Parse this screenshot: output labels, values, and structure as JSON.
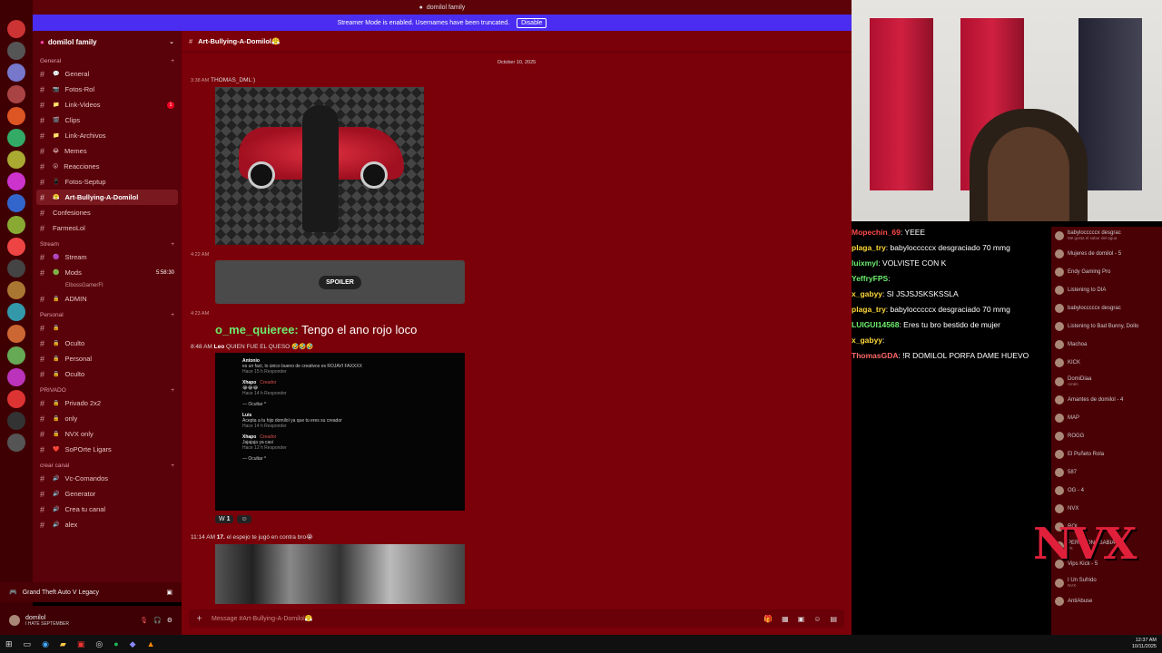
{
  "window": {
    "title": "domilol family"
  },
  "banner": {
    "text": "Streamer Mode is enabled. Usernames have been truncated.",
    "disable_label": "Disable"
  },
  "server": {
    "name": "domilol family"
  },
  "sidebar": {
    "categories": [
      {
        "label": "General",
        "channels": [
          {
            "label": "General",
            "emoji": "💬"
          },
          {
            "label": "Fotos-Rol",
            "emoji": "📷"
          },
          {
            "label": "Link-Videos",
            "emoji": "📁",
            "badge": "1"
          },
          {
            "label": "Clips",
            "emoji": "🎬"
          },
          {
            "label": "Link-Archivos",
            "emoji": "📁"
          },
          {
            "label": "Memes",
            "emoji": "😂"
          },
          {
            "label": "Reacciones",
            "emoji": "😮"
          },
          {
            "label": "Fotos-Septup",
            "emoji": "📱"
          },
          {
            "label": "Art-Bullying-A-Domilol",
            "emoji": "😤",
            "active": true
          },
          {
            "label": "Confesiones"
          },
          {
            "label": "FarmeoLol"
          }
        ]
      },
      {
        "label": "Stream",
        "channels": [
          {
            "label": "Stream",
            "emoji": "🟣"
          },
          {
            "label": "Mods",
            "emoji": "🟢",
            "time": "5:58:30"
          },
          {
            "label": "ElbossGamerFI",
            "sub": true
          },
          {
            "label": "ADMIN",
            "emoji": "🔒"
          }
        ]
      },
      {
        "label": "Personal",
        "channels": [
          {
            "label": "",
            "emoji": "🔒"
          },
          {
            "label": "Oculto",
            "emoji": "🔒"
          },
          {
            "label": "Personal",
            "emoji": "🔒"
          },
          {
            "label": "Oculto",
            "emoji": "🔒"
          }
        ]
      },
      {
        "label": "PRIVADO",
        "channels": [
          {
            "label": "Privado 2x2",
            "emoji": "🔒"
          },
          {
            "label": "only",
            "emoji": "🔒"
          },
          {
            "label": "NVX only",
            "emoji": "🔒"
          },
          {
            "label": "SoPOrte Ligars",
            "emoji": "❤️"
          }
        ]
      },
      {
        "label": "crear canal",
        "channels": [
          {
            "label": "Vc-Comandos",
            "emoji": "🔊"
          },
          {
            "label": "Generator",
            "emoji": "🔊"
          },
          {
            "label": "Crea tu canal",
            "emoji": "🔊"
          },
          {
            "label": "alex",
            "emoji": "🔊"
          }
        ]
      }
    ]
  },
  "game": {
    "label": "Grand Theft Auto V Legacy"
  },
  "user": {
    "name": "domilol",
    "status": "I HATE SEPTEMBER"
  },
  "chat": {
    "channel_name": "Art-Bullying-A-Domilol😤",
    "date_divider": "October 10, 2025",
    "msg1": {
      "time": "3:38 AM",
      "author": "THOMAS_DML:)"
    },
    "msg2": {
      "time": "4:22 AM",
      "spoiler_label": "SPOILER"
    },
    "msg3": {
      "time": "4:23 AM"
    },
    "overlay": {
      "name": "o_me_quieree:",
      "text": "Tengo el ano rojo loco"
    },
    "msg4": {
      "time": "8:48 AM",
      "author": "Leo",
      "text": "QUIEN FUE EL QUESO 🤣🤣🤣"
    },
    "shot": [
      {
        "name": "Antonio",
        "text": "es un fact, lo único bueno de creativos es ROJAVI FAXXXX",
        "meta": "Hace 15 h   Responder"
      },
      {
        "name": "Xhapo",
        "creator": "Creador",
        "text": "😂😂😂",
        "meta": "Hace 14 h   Responder"
      },
      {
        "name": "",
        "text": "— Ocultar ^",
        "meta": ""
      },
      {
        "name": "Luis",
        "text": "Acepta a tu hijo domilol ya que tu eres su creador",
        "meta": "Hace 14 h   Responder"
      },
      {
        "name": "Xhapo",
        "creator": "Creador",
        "text": "Jajajaja ya casi",
        "meta": "Hace 12 h   Responder"
      },
      {
        "name": "",
        "text": "— Ocultar ^",
        "meta": ""
      }
    ],
    "reactions": {
      "count": "1"
    },
    "msg5": {
      "time": "11:14 AM",
      "author": "17.",
      "text": "el espejo te jugó en contra bro😭"
    },
    "composer_placeholder": "Message #Art-Bullying-A-Domilol😤"
  },
  "twitch_chat": [
    {
      "user": "Mopechin_69",
      "color": "#ff4a4a",
      "text": ": YEEE"
    },
    {
      "user": "plaga_try",
      "color": "#ffd83a",
      "text": ": babylocccccx desgraciado 70 mmg"
    },
    {
      "user": "luixmyl",
      "color": "#6ef06e",
      "text": ": VOLVISTE CON K"
    },
    {
      "user": "YeffryFPS",
      "color": "#6ef06e",
      "text": ":"
    },
    {
      "user": "x_gabyy",
      "color": "#ffd83a",
      "text": ": SI JSJSJSKSKSSLA"
    },
    {
      "user": "plaga_try",
      "color": "#ffd83a",
      "text": ": babylocccccx desgraciado 70 mmg"
    },
    {
      "user": "LUIGUI14568",
      "color": "#6ef06e",
      "text": ": Eres tu bro bestido de mujer"
    },
    {
      "user": "x_gabyy",
      "color": "#ffd83a",
      "text": ":"
    },
    {
      "user": "ThomasGDA",
      "color": "#ff6a6a",
      "text": ": !R DOMILOL PORFA DAME HUEVO"
    }
  ],
  "members": {
    "rows": [
      {
        "name": "babylocccccx desgrac",
        "sub": "Me gusta el sabor del agua"
      },
      {
        "name": "Mujeres de domilol - 5"
      },
      {
        "name": "Endy Gaming Pro"
      },
      {
        "name": "Listening to DIA"
      },
      {
        "name": "babylocccccx desgrac"
      },
      {
        "name": "Listening to Bad Bunny, Dollo"
      },
      {
        "name": "Machoa"
      },
      {
        "name": "KICK"
      },
      {
        "name": "DomiDiaa",
        "sub": "Amén"
      },
      {
        "name": "Amantes de domilol - 4"
      },
      {
        "name": "MAP"
      },
      {
        "name": "ROGG"
      },
      {
        "name": "El Puñeto Rola"
      },
      {
        "name": "587"
      },
      {
        "name": "OG - 4"
      },
      {
        "name": "NVX"
      },
      {
        "name": "ROI"
      },
      {
        "name": "PEROYONOSABIA",
        "sub": "TK"
      },
      {
        "name": "Vips Kick - 5"
      },
      {
        "name": "I Un Sufrido",
        "sub": "NVX"
      },
      {
        "name": "AntiAbuse"
      }
    ],
    "logo": "NVX"
  },
  "taskbar": {
    "time": "12:37 AM",
    "date": "10/11/2025"
  }
}
